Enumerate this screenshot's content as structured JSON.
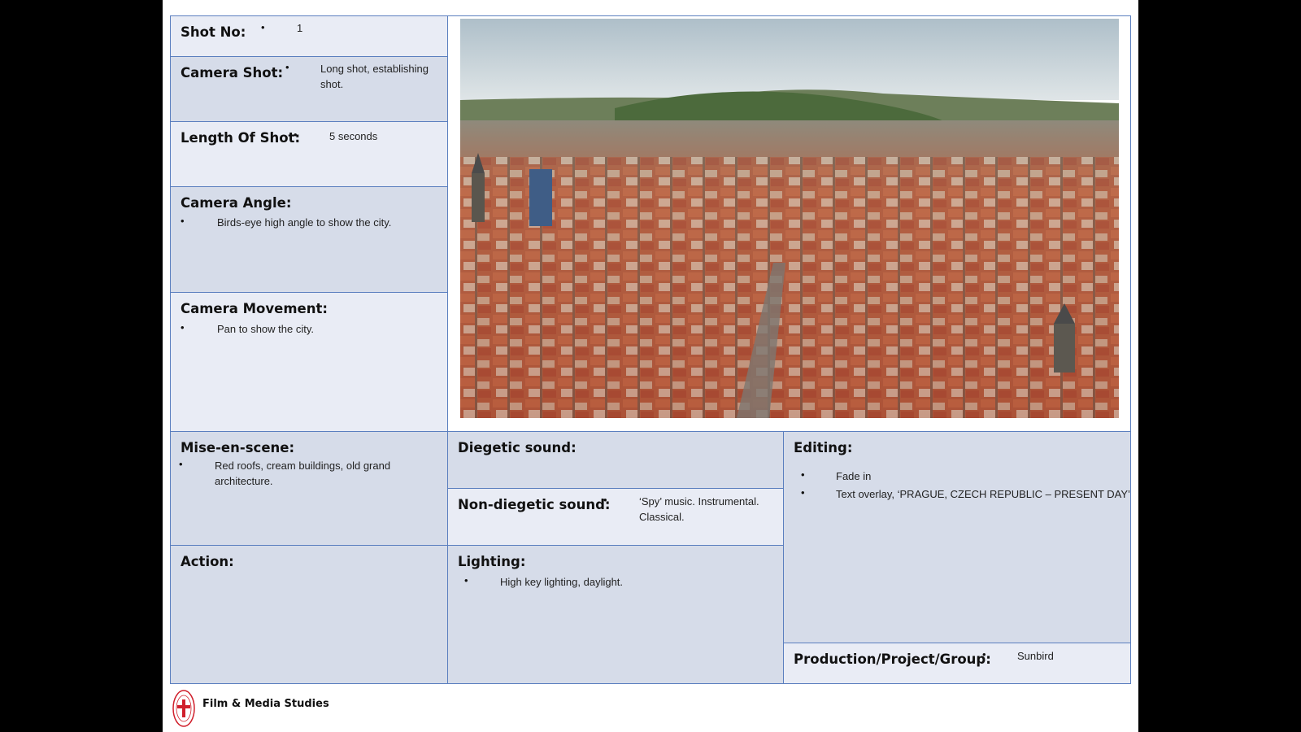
{
  "shot_no": {
    "label": "Shot No:",
    "value": "1"
  },
  "camera_shot": {
    "label": "Camera Shot:",
    "value": "Long shot, establishing shot."
  },
  "length_of_shot": {
    "label": "Length Of Shot:",
    "value": "5 seconds"
  },
  "camera_angle": {
    "label": "Camera Angle:",
    "value": "Birds-eye high angle to show the city."
  },
  "camera_movement": {
    "label": "Camera Movement:",
    "value": "Pan to show the city."
  },
  "mise_en_scene": {
    "label": "Mise-en-scene:",
    "value": "Red roofs, cream buildings, old grand architecture."
  },
  "diegetic_sound": {
    "label": "Diegetic sound:"
  },
  "non_diegetic_sound": {
    "label": "Non-diegetic sound:",
    "value": "‘Spy’ music. Instrumental. Classical."
  },
  "editing": {
    "label": "Editing:",
    "items": [
      "Fade in",
      "Text overlay, ‘PRAGUE, CZECH REPUBLIC – PRESENT DAY’"
    ]
  },
  "action": {
    "label": "Action:"
  },
  "lighting": {
    "label": "Lighting:",
    "value": "High key lighting, daylight."
  },
  "production": {
    "label": "Production/Project/Group:",
    "value": "Sunbird"
  },
  "footer": {
    "title": "Film & Media Studies"
  },
  "bullet_char": "•",
  "colors": {
    "border": "#5b7fbf",
    "cell_dark": "#d6dce9",
    "cell_light": "#e9ecf5",
    "logo_red": "#d01f2b"
  }
}
